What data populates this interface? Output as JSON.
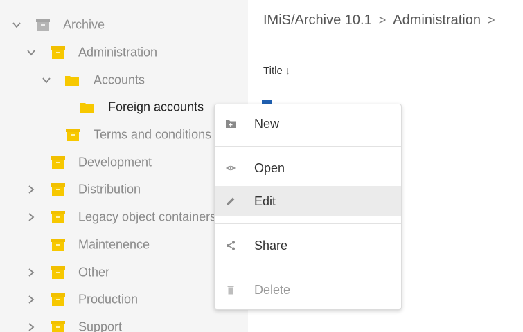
{
  "tree": {
    "items": [
      {
        "label": "Archive"
      },
      {
        "label": "Administration"
      },
      {
        "label": "Accounts"
      },
      {
        "label": "Foreign accounts"
      },
      {
        "label": "Terms and conditions"
      },
      {
        "label": "Development"
      },
      {
        "label": "Distribution"
      },
      {
        "label": "Legacy object containers"
      },
      {
        "label": "Maintenence"
      },
      {
        "label": "Other"
      },
      {
        "label": "Production"
      },
      {
        "label": "Support"
      }
    ],
    "colors": {
      "folder": "#f7c800",
      "archive_box": "#9e9e9e"
    }
  },
  "breadcrumb": {
    "items": [
      "IMiS/Archive 10.1",
      "Administration"
    ],
    "separator": ">"
  },
  "table": {
    "column_title": "Title",
    "sort_arrow": "↓"
  },
  "context_menu": {
    "items": [
      {
        "label": "New",
        "icon": "folder-plus-icon"
      },
      {
        "label": "Open",
        "icon": "eye-icon"
      },
      {
        "label": "Edit",
        "icon": "pencil-icon"
      },
      {
        "label": "Share",
        "icon": "share-icon"
      },
      {
        "label": "Delete",
        "icon": "trash-icon"
      }
    ]
  }
}
